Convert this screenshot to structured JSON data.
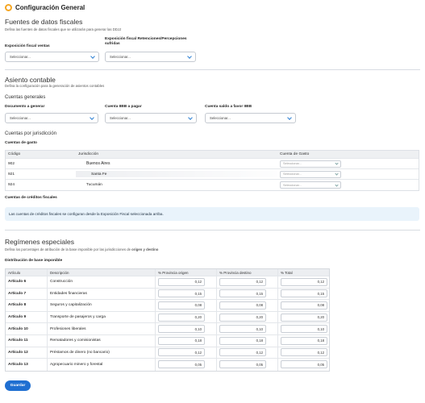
{
  "header": {
    "title": "Configuración General"
  },
  "fuentes": {
    "title": "Fuentes de datos fiscales",
    "desc": "Defina las fuentes de datos fiscales que se utilizarán para generar las DDJJ",
    "field1_label": "Exposición fiscal ventas",
    "field1_value": "Seleccionar...",
    "field2_label": "Exposición fiscal Retenciones/Percepciones sufridas",
    "field2_value": "Seleccionar..."
  },
  "asiento": {
    "title": "Asiento contable",
    "desc": "Defina la configuración para la generación de asientos contables",
    "generales_title": "Cuentas generales",
    "doc_label": "Documento a generar",
    "doc_value": "Seleccionar...",
    "iibb_pagar_label": "Cuenta IIBB a pagar",
    "iibb_pagar_value": "Seleccionar...",
    "iibb_favor_label": "Cuenta saldo a favor IIBB",
    "iibb_favor_value": "Seleccionar...",
    "jurisdiccion_title": "Cuentas por jurisdicción",
    "gasto_label": "Cuentas de gasto",
    "gasto_table": {
      "headers": [
        "Código",
        "Jurisdicción",
        "Cuenta de Gasto"
      ],
      "rows": [
        {
          "codigo": "902",
          "jurisdiccion": "Buenos Aires",
          "cuenta": "Seleccionar..."
        },
        {
          "codigo": "921",
          "jurisdiccion": "Santa Fe",
          "cuenta": "Seleccionar..."
        },
        {
          "codigo": "924",
          "jurisdiccion": "Tucumán",
          "cuenta": "Seleccionar..."
        }
      ]
    },
    "creditos_label": "Cuentas de créditos fiscales",
    "creditos_info": "Las cuentas de créditos fiscales se configuran desde la Exposición Fiscal seleccionada arriba."
  },
  "regimenes": {
    "title": "Regímenes especiales",
    "desc_prefix": "Defina los porcentajes de atribución de la base imponible por las jurisdicciones de ",
    "desc_bold": "origen y destino",
    "dist_label": "Distribución de base imponible",
    "headers": [
      "Artículo",
      "Descripción",
      "% Provincia origen",
      "% Provincia destino",
      "% Total"
    ],
    "rows": [
      {
        "articulo": "Artículo 6",
        "descripcion": "Construcción",
        "origen": "0,12",
        "destino": "0,12",
        "total": "0,12"
      },
      {
        "articulo": "Artículo 7",
        "descripcion": "Entidades financieras",
        "origen": "0,15",
        "destino": "0,15",
        "total": "0,15"
      },
      {
        "articulo": "Artículo 8",
        "descripcion": "Seguros y capitalización",
        "origen": "0,08",
        "destino": "0,08",
        "total": "0,08"
      },
      {
        "articulo": "Artículo 9",
        "descripcion": "Transporte de pasajeros y carga",
        "origen": "0,20",
        "destino": "0,20",
        "total": "0,20"
      },
      {
        "articulo": "Artículo 10",
        "descripcion": "Profesiones liberales",
        "origen": "0,10",
        "destino": "0,10",
        "total": "0,10"
      },
      {
        "articulo": "Artículo 11",
        "descripcion": "Rematadores y comisionistas",
        "origen": "0,18",
        "destino": "0,18",
        "total": "0,18"
      },
      {
        "articulo": "Artículo 12",
        "descripcion": "Préstamos de dinero (no bancario)",
        "origen": "0,12",
        "destino": "0,12",
        "total": "0,12"
      },
      {
        "articulo": "Artículo 13",
        "descripcion": "Agropecuario minero y forestal",
        "origen": "0,05",
        "destino": "0,05",
        "total": "0,05"
      }
    ]
  },
  "actions": {
    "save_label": "Guardar"
  },
  "colors": {
    "accent": "#1f6fd1",
    "gear": "#f5a623",
    "info_bg": "#e9f3fb"
  }
}
